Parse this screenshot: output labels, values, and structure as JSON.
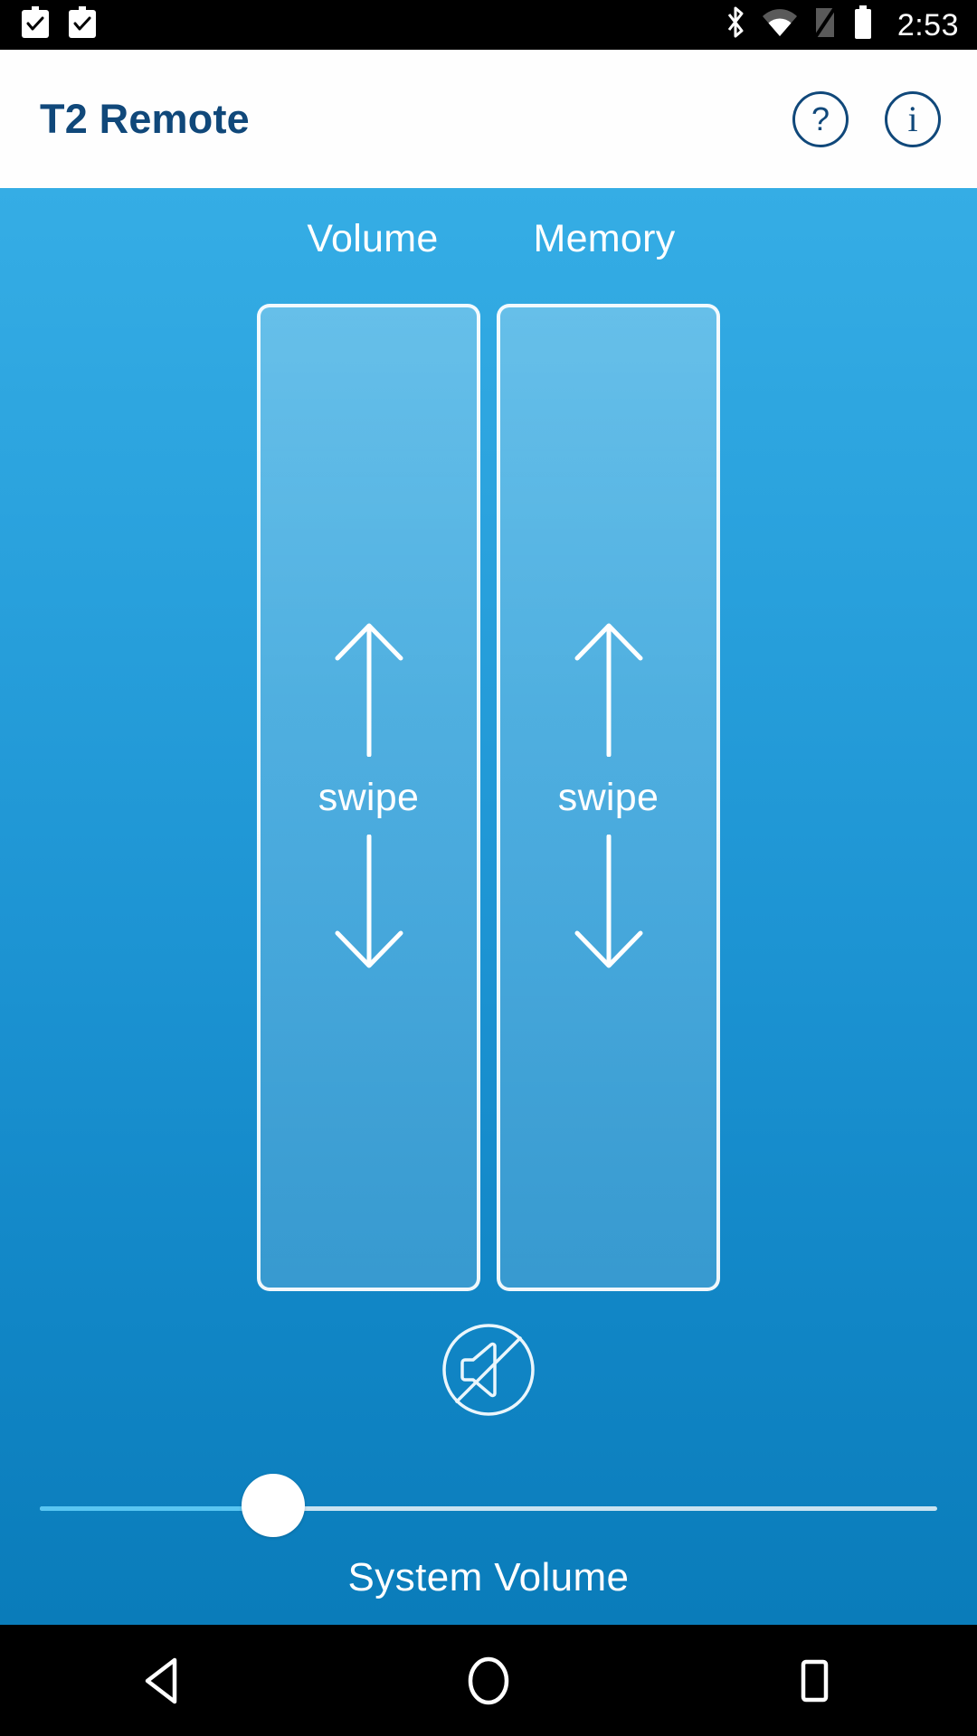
{
  "status_bar": {
    "time": "2:53",
    "left_icons": [
      "task-complete-icon",
      "task-complete-icon"
    ],
    "right_icons": [
      "bluetooth-icon",
      "wifi-icon",
      "sim-off-icon",
      "battery-icon"
    ]
  },
  "app_bar": {
    "title": "T2 Remote",
    "help_label": "?",
    "info_label": "i",
    "title_color": "#10487a"
  },
  "main": {
    "pads": [
      {
        "header": "Volume",
        "swipe_label": "swipe",
        "up_icon": "arrow-up-icon",
        "down_icon": "arrow-down-icon"
      },
      {
        "header": "Memory",
        "swipe_label": "swipe",
        "up_icon": "arrow-up-icon",
        "down_icon": "arrow-down-icon"
      }
    ],
    "mute_icon": "volume-mute-icon",
    "slider": {
      "caption": "System Volume",
      "value_percent": 26,
      "fill_color": "#59c6f2",
      "track_color": "#ffffff"
    },
    "background_top_color": "#35ade5",
    "background_bottom_color": "#0a7cba"
  },
  "nav_bar": {
    "back_icon": "triangle-back-icon",
    "home_icon": "circle-home-icon",
    "recents_icon": "square-recents-icon"
  }
}
